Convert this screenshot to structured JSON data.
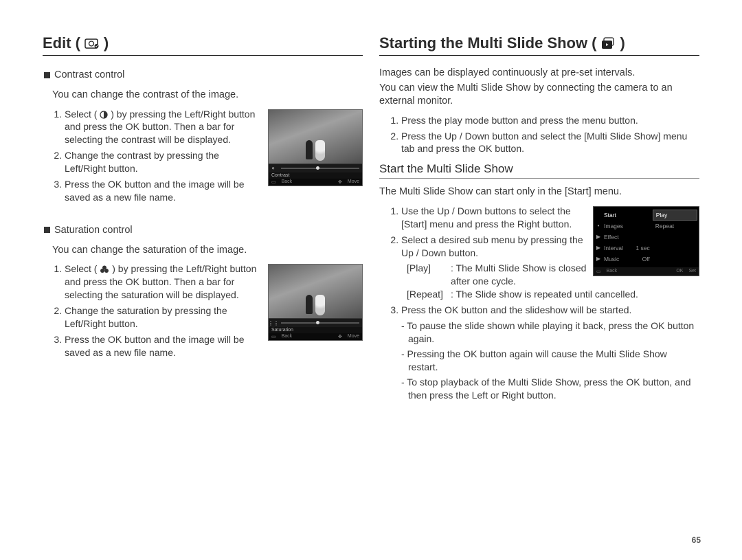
{
  "page_number": "65",
  "left": {
    "heading": "Edit",
    "heading_icon": "edit-icon",
    "contrast": {
      "title": "Contrast control",
      "desc": "You can change the contrast of the image.",
      "steps": [
        "Select ( ◐ ) by pressing the Left/Right button and press the OK button. Then a bar for selecting the contrast will be displayed.",
        "Change the contrast by pressing the Left/Right button.",
        "Press the OK button and the image will be saved as a new file name."
      ],
      "fig": {
        "label": "Contrast",
        "back": "Back",
        "move": "Move"
      }
    },
    "saturation": {
      "title": "Saturation control",
      "desc": "You can change the saturation of the image.",
      "steps": [
        "Select ( ⋯ ) by pressing the Left/Right button and press the OK button. Then a bar for selecting the saturation will be displayed.",
        "Change the saturation by pressing the Left/Right button.",
        "Press the OK button and the image will be saved as a new file name."
      ],
      "fig": {
        "label": "Saturation",
        "back": "Back",
        "move": "Move"
      }
    }
  },
  "right": {
    "heading": "Starting the Multi Slide Show",
    "heading_icon": "slideshow-icon",
    "intro": [
      "Images can be displayed continuously at pre-set intervals.",
      "You can view the Multi Slide Show by connecting the camera to an external monitor."
    ],
    "intro_steps": [
      "Press the play mode button and press the menu button.",
      "Press the Up / Down button and select the [Multi Slide Show] menu tab and press the OK button."
    ],
    "sub_heading": "Start the Multi Slide Show",
    "sub_intro": "The Multi Slide Show can start only in the [Start] menu.",
    "sub_steps": {
      "s1": "Use the Up / Down buttons to select the [Start] menu and press the Right button.",
      "s2_lead": "Select a desired sub menu by pressing the Up / Down button.",
      "s2_play_k": "[Play]",
      "s2_play_v": ": The Multi Slide Show is closed after one cycle.",
      "s2_repeat_k": "[Repeat]",
      "s2_repeat_v": ": The Slide show is repeated until cancelled.",
      "s3": "Press the OK button and the slideshow will be started.",
      "s3_a": "- To pause the slide shown while playing it back, press the OK button again.",
      "s3_b": "- Pressing the OK button again will cause the Multi Slide Show restart.",
      "s3_c": "- To stop playback of the Multi Slide Show, press the OK button, and then press the Left or Right button."
    },
    "menu_fig": {
      "rows": [
        {
          "icon": "▶",
          "label": "Start"
        },
        {
          "icon": "",
          "label": "Images"
        },
        {
          "icon": "▶",
          "label": "Effect"
        },
        {
          "icon": "▶",
          "label": "Interval",
          "val": "1 sec"
        },
        {
          "icon": "▶",
          "label": "Music",
          "val": "Off"
        }
      ],
      "opts": [
        "Play",
        "Repeat"
      ],
      "back": "Back",
      "set": "Set"
    }
  }
}
